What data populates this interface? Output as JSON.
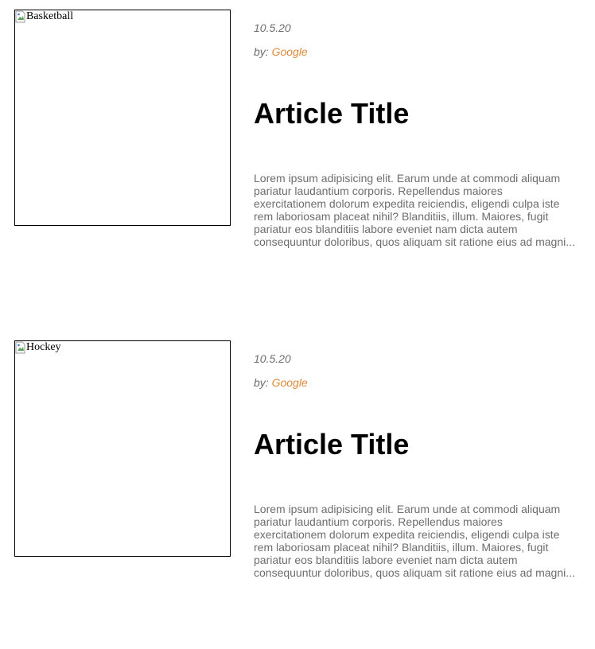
{
  "articles": [
    {
      "image_alt": "Basketball",
      "date": "10.5.20",
      "by_label": "by:",
      "author": "Google",
      "title": "Article Title",
      "excerpt": "Lorem ipsum adipisicing elit. Earum unde at commodi aliquam pariatur laudantium corporis. Repellendus maiores exercitationem dolorum expedita reiciendis, eligendi culpa iste rem laboriosam placeat nihil? Blanditiis, illum. Maiores, fugit pariatur eos blanditiis labore eveniet nam dicta autem consequuntur doloribus, quos aliquam sit ratione eius ad magni..."
    },
    {
      "image_alt": "Hockey",
      "date": "10.5.20",
      "by_label": "by:",
      "author": "Google",
      "title": "Article Title",
      "excerpt": "Lorem ipsum adipisicing elit. Earum unde at commodi aliquam pariatur laudantium corporis. Repellendus maiores exercitationem dolorum expedita reiciendis, eligendi culpa iste rem laboriosam placeat nihil? Blanditiis, illum. Maiores, fugit pariatur eos blanditiis labore eveniet nam dicta autem consequuntur doloribus, quos aliquam sit ratione eius ad magni..."
    }
  ],
  "colors": {
    "author_link": "#e08a3a",
    "muted_text": "#6d6d6d",
    "title_text": "#000000"
  }
}
